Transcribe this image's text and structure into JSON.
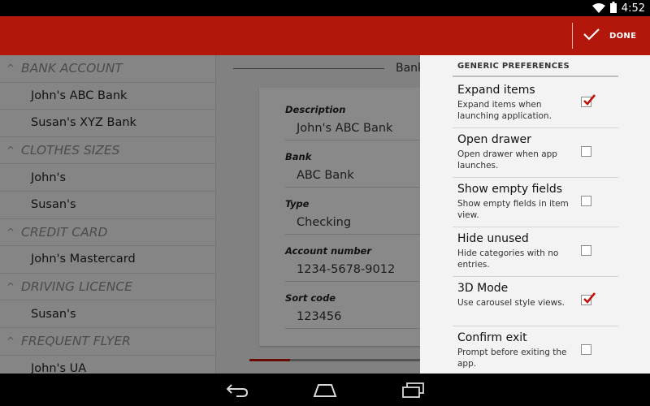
{
  "status_bar": {
    "time": "4:52",
    "icons": [
      "wifi-icon",
      "battery-icon"
    ]
  },
  "action_bar": {
    "done_label": "DONE",
    "color": "#b3160b"
  },
  "drawer": {
    "rows": [
      {
        "kind": "category",
        "label": "BANK ACCOUNT"
      },
      {
        "kind": "item",
        "label": "John's ABC Bank"
      },
      {
        "kind": "item",
        "label": "Susan's XYZ Bank"
      },
      {
        "kind": "category",
        "label": "CLOTHES SIZES"
      },
      {
        "kind": "item",
        "label": "John's"
      },
      {
        "kind": "item",
        "label": "Susan's"
      },
      {
        "kind": "category",
        "label": "CREDIT CARD"
      },
      {
        "kind": "item",
        "label": "John's Mastercard"
      },
      {
        "kind": "category",
        "label": "DRIVING LICENCE"
      },
      {
        "kind": "item",
        "label": "Susan's"
      },
      {
        "kind": "category",
        "label": "FREQUENT FLYER"
      },
      {
        "kind": "item",
        "label": "John's UA"
      }
    ]
  },
  "detail": {
    "heading": "Bank",
    "fields": [
      {
        "label": "Description",
        "value": "John's ABC Bank"
      },
      {
        "label": "Bank",
        "value": "ABC Bank"
      },
      {
        "label": "Type",
        "value": "Checking"
      },
      {
        "label": "Account number",
        "value": "1234-5678-9012"
      },
      {
        "label": "Sort code",
        "value": "123456"
      }
    ],
    "page_progress": 0.2
  },
  "preferences": {
    "header": "GENERIC PREFERENCES",
    "items": [
      {
        "title": "Expand items",
        "summary": "Expand items when launching application.",
        "checked": true
      },
      {
        "title": "Open drawer",
        "summary": "Open drawer when app launches.",
        "checked": false
      },
      {
        "title": "Show empty fields",
        "summary": "Show empty fields in item view.",
        "checked": false
      },
      {
        "title": "Hide unused",
        "summary": "Hide categories with no entries.",
        "checked": false
      },
      {
        "title": "3D Mode",
        "summary": "Use carousel style views.",
        "checked": true
      },
      {
        "title": "Confirm exit",
        "summary": "Prompt before exiting the app.",
        "checked": false
      }
    ]
  },
  "nav_bar": {
    "buttons": [
      "back-icon",
      "home-icon",
      "recent-apps-icon"
    ]
  }
}
